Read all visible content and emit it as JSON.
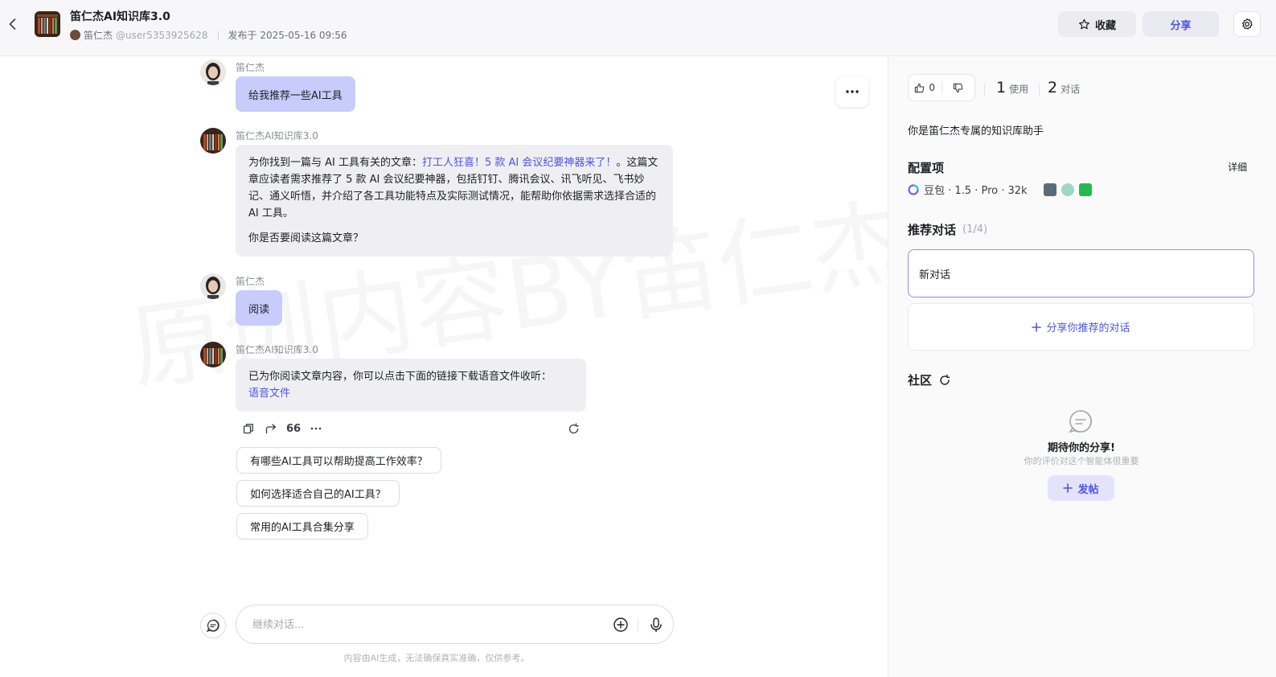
{
  "header": {
    "title": "笛仁杰AI知识库3.0",
    "author": "笛仁杰",
    "handle": "@user5353925628",
    "published": "发布于 2025-05-16 09:56",
    "fav_label": "收藏",
    "share_label": "分享"
  },
  "chat": {
    "user_name": "笛仁杰",
    "bot_name": "笛仁杰AI知识库3.0",
    "msg1": "给我推荐一些AI工具",
    "msg2_pre": "为你找到一篇与 AI 工具有关的文章：",
    "msg2_link": "打工人狂喜！5 款 AI 会议纪要神器来了！",
    "msg2_post": "。这篇文章应读者需求推荐了 5 款 AI 会议纪要神器，包括钉钉、腾讯会议、讯飞听见、飞书妙记、通义听悟，并介绍了各工具功能特点及实际测试情况，能帮助你依据需求选择合适的 AI 工具。",
    "msg2_question": "你是否要阅读这篇文章？",
    "msg3": "阅读",
    "msg4_text": "已为你阅读文章内容，你可以点击下面的链接下载语音文件收听：",
    "msg4_link": "语音文件",
    "quote_label": "66",
    "suggestions": [
      "有哪些AI工具可以帮助提高工作效率？",
      "如何选择适合自己的AI工具？",
      "常用的AI工具合集分享"
    ],
    "input_placeholder": "继续对话...",
    "disclaimer": "内容由AI生成，无法确保真实准确，仅供参考。",
    "watermark": "原创内容BY笛仁杰"
  },
  "panel": {
    "likes": "0",
    "uses_num": "1",
    "uses_label": "使用",
    "convs_num": "2",
    "convs_label": "对话",
    "description": "你是笛仁杰专属的知识库助手",
    "config_title": "配置项",
    "detail_label": "详细",
    "model": "豆包 · 1.5 · Pro · 32k",
    "recommend_title": "推荐对话",
    "recommend_count": "(1/4)",
    "new_conv": "新对话",
    "share_conv": "分享你推荐的对话",
    "community_title": "社区",
    "empty_title": "期待你的分享!",
    "empty_sub": "你的评价对这个智能体很重要",
    "post_label": "发帖"
  },
  "colors": {
    "accent": "#4d53e8",
    "user_bubble": "#c8ccfa",
    "bot_bubble": "#efeff3"
  }
}
